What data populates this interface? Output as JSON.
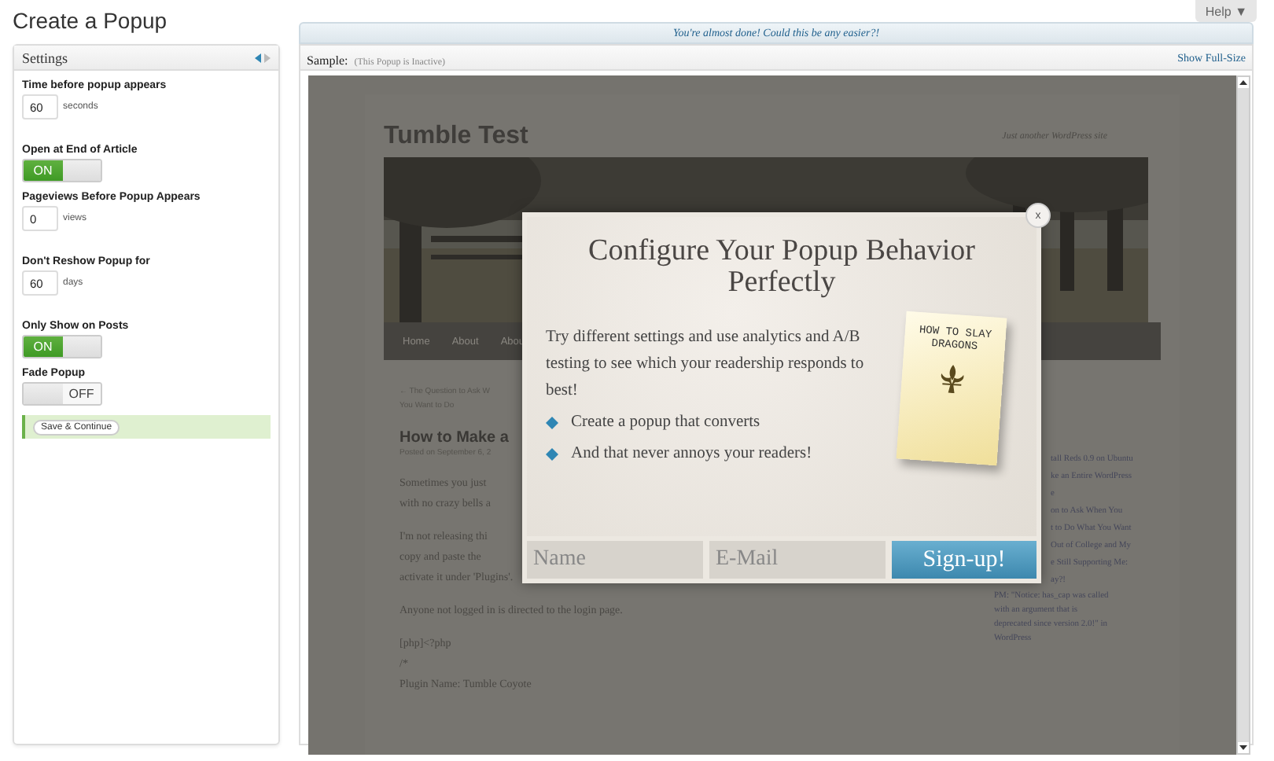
{
  "page": {
    "title": "Create a Popup",
    "help": "Help ▼"
  },
  "settings": {
    "title": "Settings",
    "fields": [
      {
        "kind": "number",
        "label": "Time before popup appears",
        "value": "60",
        "unit": "seconds"
      },
      {
        "kind": "toggle",
        "label": "Open at End of Article",
        "on": true,
        "text": "ON"
      },
      {
        "kind": "number",
        "label": "Pageviews Before Popup Appears",
        "value": "0",
        "unit": "views"
      },
      {
        "kind": "number",
        "label": "Don't Reshow Popup for",
        "value": "60",
        "unit": "days"
      },
      {
        "kind": "toggle",
        "label": "Only Show on Posts",
        "on": true,
        "text": "ON"
      },
      {
        "kind": "toggle",
        "label": "Fade Popup",
        "on": false,
        "text": "OFF"
      }
    ],
    "save": "Save & Continue"
  },
  "notice": "You're almost done! Could this be any easier?!",
  "sample": {
    "title": "Sample:",
    "status": "(This Popup is Inactive)",
    "full_size": "Show Full-Size",
    "site": {
      "title": "Tumble Test",
      "tagline": "Just another WordPress site",
      "nav": [
        "Home",
        "About",
        "Abou"
      ],
      "prev_link": [
        "← The Question to Ask W",
        "You Want to Do"
      ],
      "post_title": "How to Make a",
      "meta": "Posted on September 6, 2",
      "paragraphs": [
        [
          "Sometimes you just",
          "with no crazy bells a"
        ],
        [
          "I'm not releasing thi",
          "copy and paste the",
          "activate it under 'Plugins'."
        ],
        [
          "Anyone not logged in is directed to the login page."
        ],
        [
          "[php]<?php",
          "/*",
          "Plugin Name: Tumble Coyote"
        ]
      ],
      "sidebar_covered": [
        "tall Reds 0.9 on Ubuntu",
        "ke an Entire WordPress",
        "e",
        "on to Ask When You",
        "t to Do What You Want",
        "Out of College and My",
        "e Still Supporting Me:",
        "ay?!"
      ],
      "sidebar": [
        "PM: \"Notice: has_cap was called",
        "with an argument that is",
        "deprecated since version 2.0!\" in",
        "WordPress"
      ]
    },
    "popup": {
      "close": "x",
      "heading": "Configure Your Popup Behavior Perfectly",
      "body": "Try different settings and use analytics and A/B testing to see which your readership responds to best!",
      "bullets": [
        "Create a popup that converts",
        "And that never annoys your readers!"
      ],
      "book": {
        "title": "HOW TO SLAY DRAGONS"
      },
      "name_placeholder": "Name",
      "email_placeholder": "E-Mail",
      "button": "Sign-up!"
    }
  }
}
